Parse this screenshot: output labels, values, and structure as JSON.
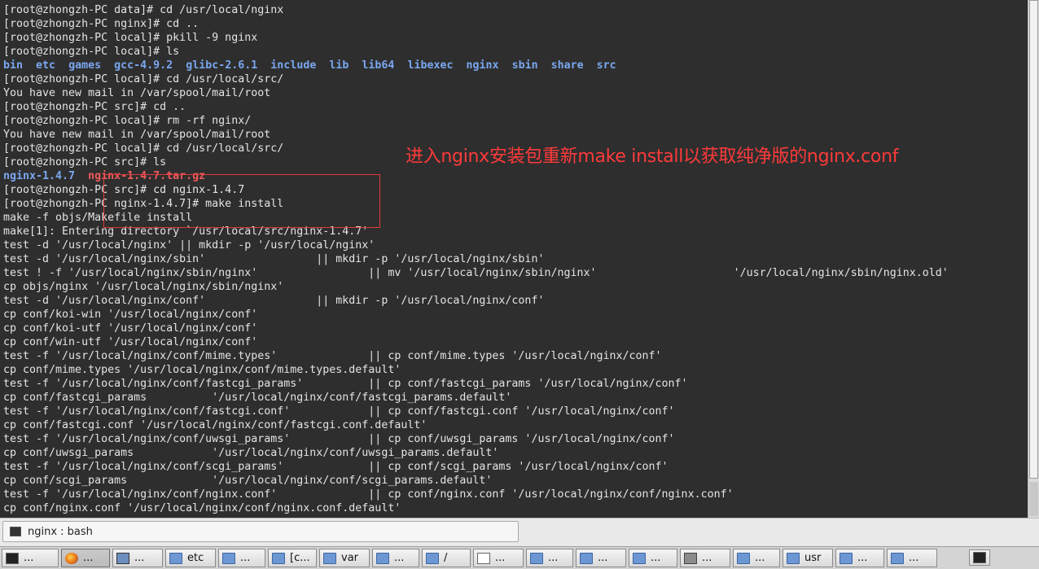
{
  "terminal": {
    "lines": [
      [
        {
          "t": "[root@zhongzh-PC data]# cd /usr/local/nginx"
        }
      ],
      [
        {
          "t": "[root@zhongzh-PC nginx]# cd .."
        }
      ],
      [
        {
          "t": "[root@zhongzh-PC local]# pkill -9 nginx"
        }
      ],
      [
        {
          "t": "[root@zhongzh-PC local]# ls"
        }
      ],
      [
        {
          "t": "bin",
          "c": "dir"
        },
        {
          "t": "  "
        },
        {
          "t": "etc",
          "c": "dir"
        },
        {
          "t": "  "
        },
        {
          "t": "games",
          "c": "dir"
        },
        {
          "t": "  "
        },
        {
          "t": "gcc-4.9.2",
          "c": "dir"
        },
        {
          "t": "  "
        },
        {
          "t": "glibc-2.6.1",
          "c": "dir"
        },
        {
          "t": "  "
        },
        {
          "t": "include",
          "c": "dir"
        },
        {
          "t": "  "
        },
        {
          "t": "lib",
          "c": "dir"
        },
        {
          "t": "  "
        },
        {
          "t": "lib64",
          "c": "dir"
        },
        {
          "t": "  "
        },
        {
          "t": "libexec",
          "c": "dir"
        },
        {
          "t": "  "
        },
        {
          "t": "nginx",
          "c": "dir"
        },
        {
          "t": "  "
        },
        {
          "t": "sbin",
          "c": "dir"
        },
        {
          "t": "  "
        },
        {
          "t": "share",
          "c": "dir"
        },
        {
          "t": "  "
        },
        {
          "t": "src",
          "c": "dir"
        }
      ],
      [
        {
          "t": "[root@zhongzh-PC local]# cd /usr/local/src/"
        }
      ],
      [
        {
          "t": "You have new mail in /var/spool/mail/root"
        }
      ],
      [
        {
          "t": "[root@zhongzh-PC src]# cd .."
        }
      ],
      [
        {
          "t": "[root@zhongzh-PC local]# rm -rf nginx/"
        }
      ],
      [
        {
          "t": "You have new mail in /var/spool/mail/root"
        }
      ],
      [
        {
          "t": "[root@zhongzh-PC local]# cd /usr/local/src/"
        }
      ],
      [
        {
          "t": "[root@zhongzh-PC src]# ls"
        }
      ],
      [
        {
          "t": "nginx-1.4.7",
          "c": "pkg"
        },
        {
          "t": "  "
        },
        {
          "t": "nginx-1.4.7.tar.gz",
          "c": "tar"
        }
      ],
      [
        {
          "t": "[root@zhongzh-PC src]# cd nginx-1.4.7"
        }
      ],
      [
        {
          "t": "[root@zhongzh-PC nginx-1.4.7]# make install"
        }
      ],
      [
        {
          "t": "make -f objs/Makefile install"
        }
      ],
      [
        {
          "t": "make[1]: Entering directory `/usr/local/src/nginx-1.4.7'"
        }
      ],
      [
        {
          "t": "test -d '/usr/local/nginx' || mkdir -p '/usr/local/nginx'"
        }
      ],
      [
        {
          "t": "test -d '/usr/local/nginx/sbin'                 || mkdir -p '/usr/local/nginx/sbin'"
        }
      ],
      [
        {
          "t": "test ! -f '/usr/local/nginx/sbin/nginx'                 || mv '/usr/local/nginx/sbin/nginx'                     '/usr/local/nginx/sbin/nginx.old'"
        }
      ],
      [
        {
          "t": "cp objs/nginx '/usr/local/nginx/sbin/nginx'"
        }
      ],
      [
        {
          "t": "test -d '/usr/local/nginx/conf'                 || mkdir -p '/usr/local/nginx/conf'"
        }
      ],
      [
        {
          "t": "cp conf/koi-win '/usr/local/nginx/conf'"
        }
      ],
      [
        {
          "t": "cp conf/koi-utf '/usr/local/nginx/conf'"
        }
      ],
      [
        {
          "t": "cp conf/win-utf '/usr/local/nginx/conf'"
        }
      ],
      [
        {
          "t": "test -f '/usr/local/nginx/conf/mime.types'              || cp conf/mime.types '/usr/local/nginx/conf'"
        }
      ],
      [
        {
          "t": "cp conf/mime.types '/usr/local/nginx/conf/mime.types.default'"
        }
      ],
      [
        {
          "t": "test -f '/usr/local/nginx/conf/fastcgi_params'          || cp conf/fastcgi_params '/usr/local/nginx/conf'"
        }
      ],
      [
        {
          "t": "cp conf/fastcgi_params          '/usr/local/nginx/conf/fastcgi_params.default'"
        }
      ],
      [
        {
          "t": "test -f '/usr/local/nginx/conf/fastcgi.conf'            || cp conf/fastcgi.conf '/usr/local/nginx/conf'"
        }
      ],
      [
        {
          "t": "cp conf/fastcgi.conf '/usr/local/nginx/conf/fastcgi.conf.default'"
        }
      ],
      [
        {
          "t": "test -f '/usr/local/nginx/conf/uwsgi_params'            || cp conf/uwsgi_params '/usr/local/nginx/conf'"
        }
      ],
      [
        {
          "t": "cp conf/uwsgi_params            '/usr/local/nginx/conf/uwsgi_params.default'"
        }
      ],
      [
        {
          "t": "test -f '/usr/local/nginx/conf/scgi_params'             || cp conf/scgi_params '/usr/local/nginx/conf'"
        }
      ],
      [
        {
          "t": "cp conf/scgi_params             '/usr/local/nginx/conf/scgi_params.default'"
        }
      ],
      [
        {
          "t": "test -f '/usr/local/nginx/conf/nginx.conf'              || cp conf/nginx.conf '/usr/local/nginx/conf/nginx.conf'"
        }
      ],
      [
        {
          "t": "cp conf/nginx.conf '/usr/local/nginx/conf/nginx.conf.default'"
        }
      ]
    ],
    "colors": {
      "background": "#2e2e2e",
      "text": "#e4e4e4",
      "directory": "#7aa7ef",
      "archive": "#ef5a5a"
    }
  },
  "annotation": {
    "text": "进入nginx安装包重新make install以获取纯净版的nginx.conf",
    "color": "#ff3a3a"
  },
  "tab": {
    "label": "nginx : bash",
    "icon": "terminal-icon"
  },
  "taskbar": {
    "items": [
      {
        "label": "...",
        "icon": "terminal-icon",
        "active": false
      },
      {
        "label": "...",
        "icon": "firefox-icon",
        "active": true
      },
      {
        "label": "...",
        "icon": "computer-icon",
        "active": false
      },
      {
        "label": "etc",
        "icon": "folder-icon",
        "active": false
      },
      {
        "label": "...",
        "icon": "folder-icon",
        "active": false
      },
      {
        "label": "[c...",
        "icon": "folder-icon",
        "active": false
      },
      {
        "label": "var",
        "icon": "folder-icon",
        "active": false
      },
      {
        "label": "...",
        "icon": "folder-icon",
        "active": false
      },
      {
        "label": "/",
        "icon": "folder-icon",
        "active": false
      },
      {
        "label": "...",
        "icon": "document-icon",
        "active": false
      },
      {
        "label": "...",
        "icon": "folder-icon",
        "active": false
      },
      {
        "label": "...",
        "icon": "folder-icon",
        "active": false
      },
      {
        "label": "...",
        "icon": "folder-icon",
        "active": false
      },
      {
        "label": "...",
        "icon": "settings-icon",
        "active": false
      },
      {
        "label": "...",
        "icon": "folder-icon",
        "active": false
      },
      {
        "label": "usr",
        "icon": "folder-icon",
        "active": false
      },
      {
        "label": "...",
        "icon": "folder-icon",
        "active": false
      },
      {
        "label": "...",
        "icon": "folder-icon",
        "active": false
      }
    ],
    "tray_icon": "terminal-icon"
  }
}
